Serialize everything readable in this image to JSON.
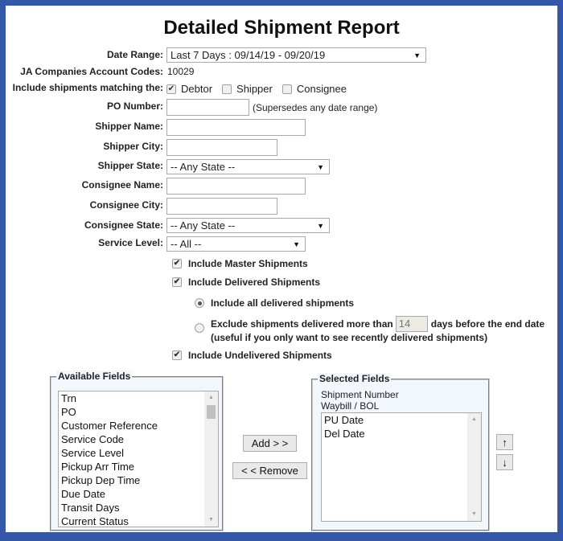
{
  "title": "Detailed Shipment Report",
  "form": {
    "date_range": {
      "label": "Date Range:",
      "value": "Last 7 Days : 09/14/19 - 09/20/19"
    },
    "account_codes": {
      "label": "JA Companies Account Codes:",
      "value": "10029"
    },
    "matching": {
      "label": "Include shipments matching the:",
      "options": [
        {
          "label": "Debtor",
          "checked": true
        },
        {
          "label": "Shipper",
          "checked": false
        },
        {
          "label": "Consignee",
          "checked": false
        }
      ]
    },
    "po_number": {
      "label": "PO Number:",
      "value": "",
      "note": "(Supersedes any date range)"
    },
    "shipper_name": {
      "label": "Shipper Name:",
      "value": ""
    },
    "shipper_city": {
      "label": "Shipper City:",
      "value": ""
    },
    "shipper_state": {
      "label": "Shipper State:",
      "value": "-- Any State --"
    },
    "consignee_name": {
      "label": "Consignee Name:",
      "value": ""
    },
    "consignee_city": {
      "label": "Consignee City:",
      "value": ""
    },
    "consignee_state": {
      "label": "Consignee State:",
      "value": "-- Any State --"
    },
    "service_level": {
      "label": "Service Level:",
      "value": "-- All --"
    }
  },
  "options": {
    "master": {
      "label": "Include Master Shipments",
      "checked": true
    },
    "delivered": {
      "label": "Include Delivered Shipments",
      "checked": true
    },
    "all_delivered": {
      "label": "Include all delivered shipments",
      "selected": true
    },
    "exclude_delivered": {
      "label_before": "Exclude shipments delivered more than",
      "days": "14",
      "label_after": "days before the end date",
      "note": "(useful if you only want to see recently delivered shipments)",
      "selected": false
    },
    "undelivered": {
      "label": "Include Undelivered Shipments",
      "checked": true
    }
  },
  "available_fields": {
    "legend": "Available Fields",
    "items": [
      "Trn",
      "PO",
      "Customer Reference",
      "Service Code",
      "Service Level",
      "Pickup Arr Time",
      "Pickup Dep Time",
      "Due Date",
      "Transit Days",
      "Current Status"
    ]
  },
  "selected_fields": {
    "legend": "Selected Fields",
    "fixed": [
      "Shipment Number",
      "Waybill / BOL"
    ],
    "items": [
      "PU Date",
      "Del Date"
    ]
  },
  "buttons": {
    "add": "Add > >",
    "remove": "< < Remove",
    "move_up": "↑",
    "move_down": "↓"
  },
  "colors": {
    "frame": "#3557a8",
    "fieldset_bg": "#f1f7fd"
  }
}
